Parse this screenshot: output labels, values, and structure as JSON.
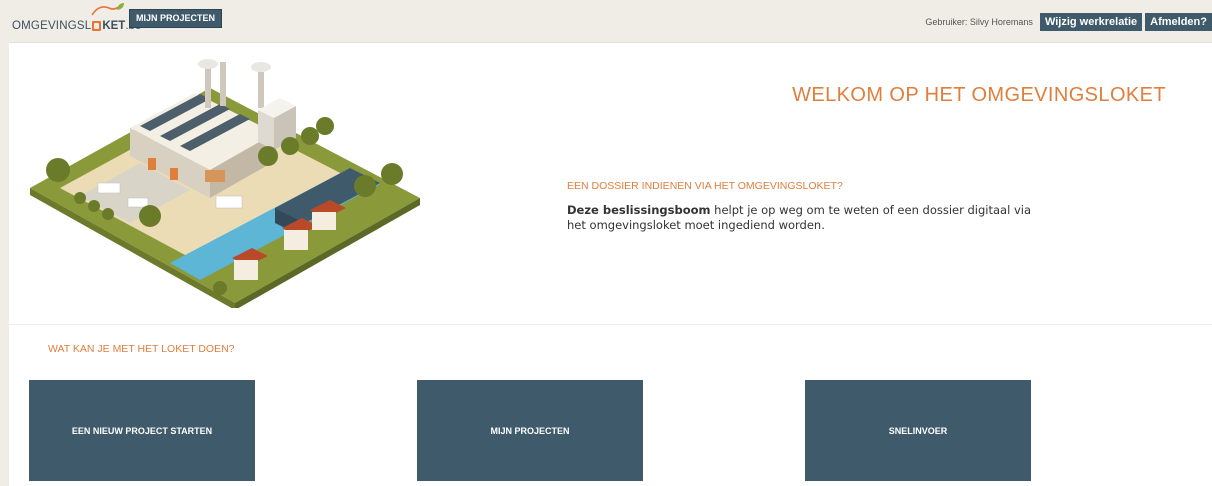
{
  "header": {
    "logo": {
      "part1": "OMGEVINGSL",
      "part2": "KET",
      "part3": ".be"
    },
    "nav_button": "MIJN PROJECTEN",
    "user_label": "Gebruiker: Silvy Horemans",
    "change_relation_button": "Wijzig werkrelatie",
    "logout_button": "Afmelden?"
  },
  "hero": {
    "title": "WELKOM OP HET OMGEVINGSLOKET",
    "dossier_heading": "EEN DOSSIER INDIENEN VIA HET OMGEVINGSLOKET?",
    "dossier_link": "Deze beslissingsboom",
    "dossier_text": " helpt je op weg om te weten of een dossier digitaal via het omgevingsloket moet ingediend worden."
  },
  "actions": {
    "heading": "WAT KAN JE MET HET LOKET DOEN?",
    "tiles": [
      {
        "label": "EEN NIEUW PROJECT STARTEN"
      },
      {
        "label": "MIJN PROJECTEN"
      },
      {
        "label": "SNELINVOER"
      }
    ]
  },
  "colors": {
    "accent_orange": "#e07e3c",
    "button_slate": "#3f5a6a",
    "topbar_bg": "#f0ede6"
  }
}
